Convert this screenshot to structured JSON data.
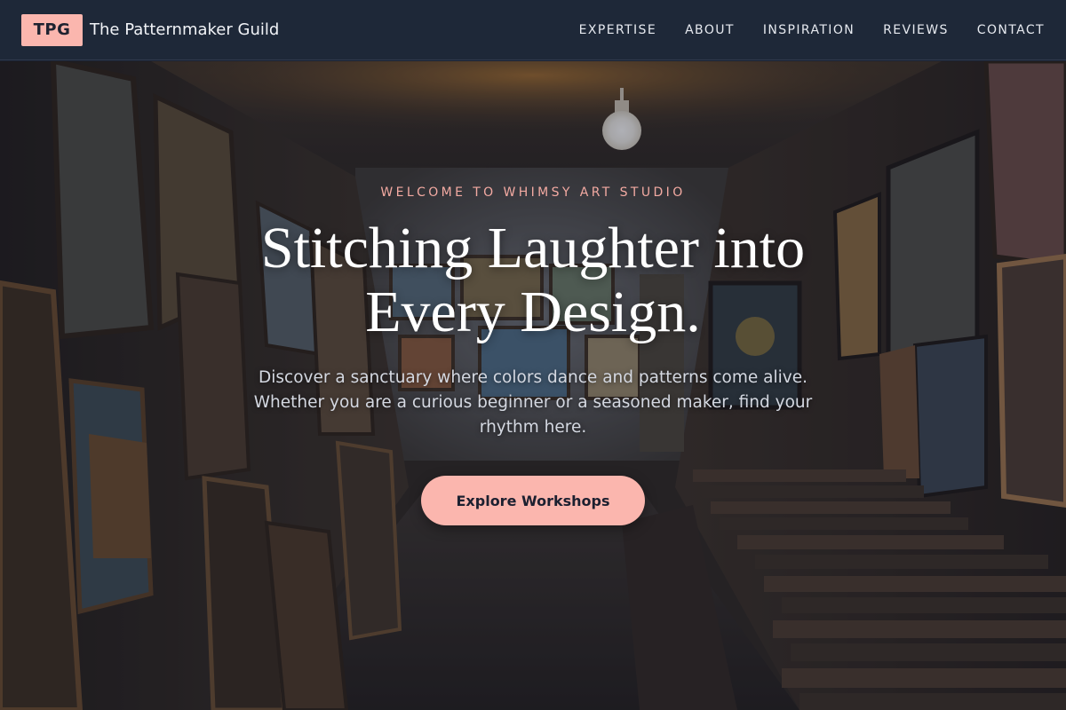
{
  "header": {
    "logo_text": "TPG",
    "brand_name": "The Patternmaker Guild",
    "nav": [
      {
        "label": "EXPERTISE"
      },
      {
        "label": "ABOUT"
      },
      {
        "label": "INSPIRATION"
      },
      {
        "label": "REVIEWS"
      },
      {
        "label": "CONTACT"
      }
    ]
  },
  "hero": {
    "eyebrow": "WELCOME TO WHIMSY ART STUDIO",
    "headline": "Stitching Laughter into Every Design.",
    "subtext": "Discover a sanctuary where colors dance and patterns come alive. Whether you are a curious beginner or a seasoned maker, find your rhythm here.",
    "cta_label": "Explore Workshops"
  },
  "colors": {
    "header_bg": "#1e2838",
    "accent": "#fbb6ae",
    "eyebrow": "#f3aaa2",
    "headline": "#ffffff"
  }
}
